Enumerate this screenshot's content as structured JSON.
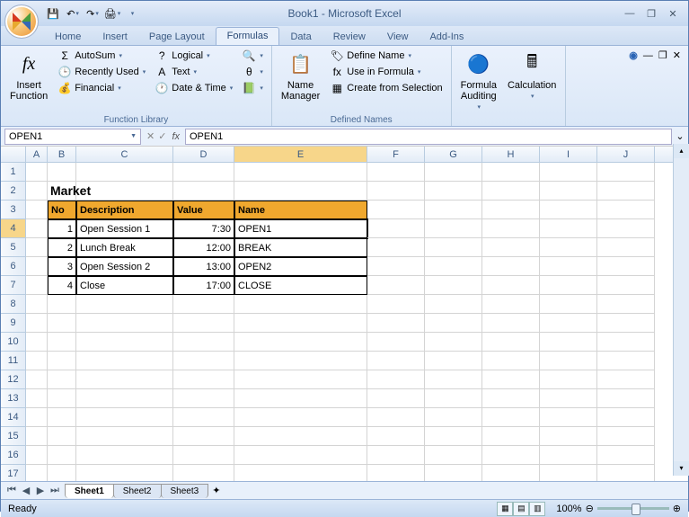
{
  "window": {
    "title": "Book1 - Microsoft Excel"
  },
  "tabs": [
    "Home",
    "Insert",
    "Page Layout",
    "Formulas",
    "Data",
    "Review",
    "View",
    "Add-Ins"
  ],
  "active_tab": "Formulas",
  "ribbon": {
    "insert_fn": "Insert\nFunction",
    "autosum": "AutoSum",
    "recent": "Recently Used",
    "financial": "Financial",
    "logical": "Logical",
    "text": "Text",
    "datetime": "Date & Time",
    "group1": "Function Library",
    "namemgr": "Name\nManager",
    "defname": "Define Name",
    "useinf": "Use in Formula",
    "createsel": "Create from Selection",
    "group2": "Defined Names",
    "faudit": "Formula\nAuditing",
    "calc": "Calculation",
    "group3": ""
  },
  "namebox": "OPEN1",
  "formula_bar": "OPEN1",
  "columns": [
    "A",
    "B",
    "C",
    "D",
    "E",
    "F",
    "G",
    "H",
    "I",
    "J"
  ],
  "sheet_title": "Market",
  "headers": {
    "no": "No",
    "desc": "Description",
    "val": "Value",
    "name": "Name"
  },
  "rows": [
    {
      "no": "1",
      "desc": "Open Session 1",
      "val": "7:30",
      "name": "OPEN1"
    },
    {
      "no": "2",
      "desc": "Lunch Break",
      "val": "12:00",
      "name": "BREAK"
    },
    {
      "no": "3",
      "desc": "Open Session 2",
      "val": "13:00",
      "name": "OPEN2"
    },
    {
      "no": "4",
      "desc": "Close",
      "val": "17:00",
      "name": "CLOSE"
    }
  ],
  "sheets": [
    "Sheet1",
    "Sheet2",
    "Sheet3"
  ],
  "status": "Ready",
  "zoom": "100%"
}
